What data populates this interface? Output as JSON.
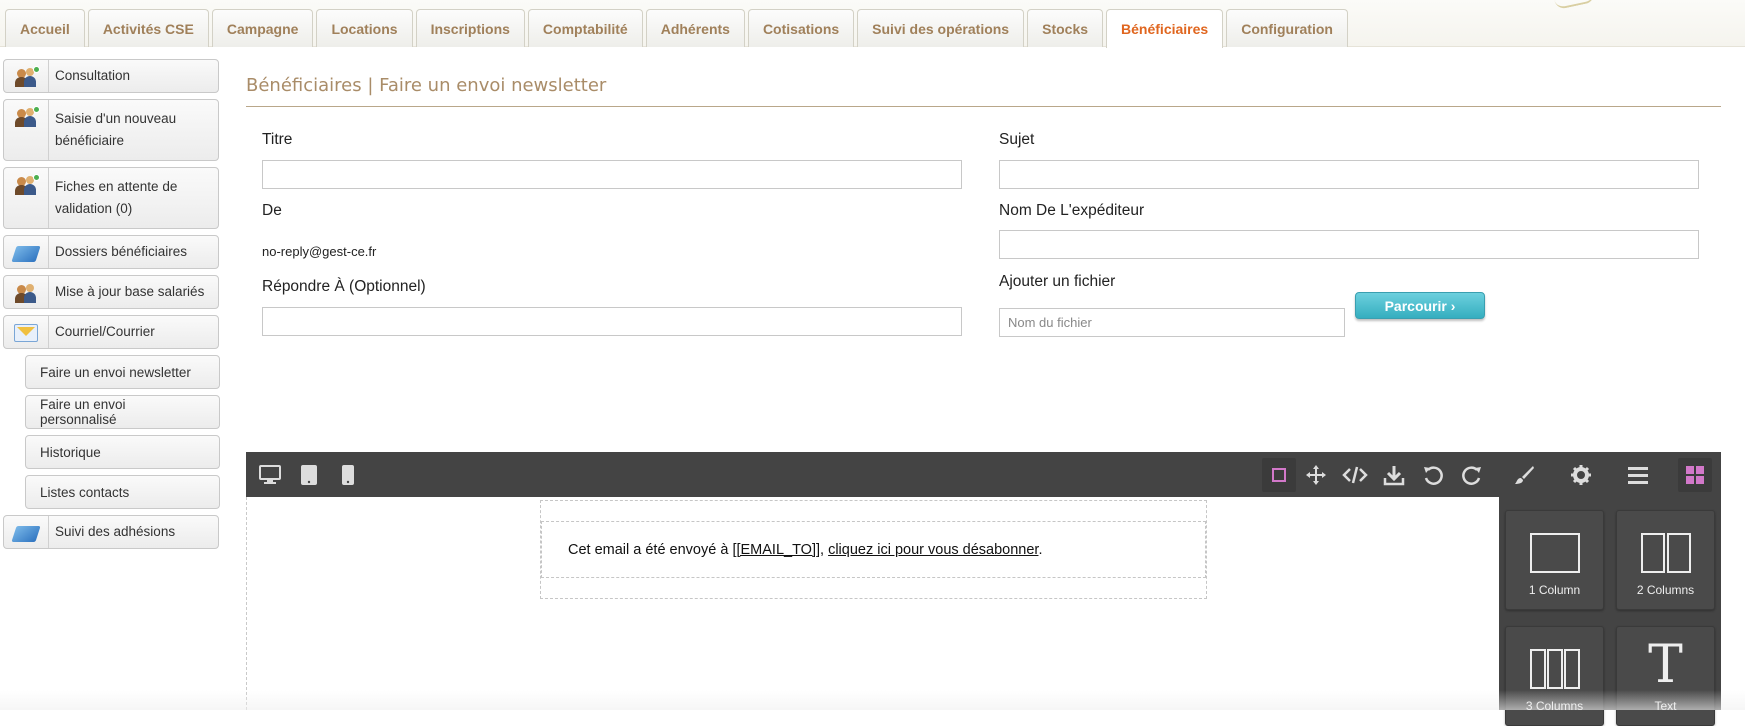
{
  "tabs": [
    {
      "label": "Accueil",
      "active": false
    },
    {
      "label": "Activités CSE",
      "active": false
    },
    {
      "label": "Campagne",
      "active": false
    },
    {
      "label": "Locations",
      "active": false
    },
    {
      "label": "Inscriptions",
      "active": false
    },
    {
      "label": "Comptabilité",
      "active": false
    },
    {
      "label": "Adhérents",
      "active": false
    },
    {
      "label": "Cotisations",
      "active": false
    },
    {
      "label": "Suivi des opérations",
      "active": false
    },
    {
      "label": "Stocks",
      "active": false
    },
    {
      "label": "Bénéficiaires",
      "active": true
    },
    {
      "label": "Configuration",
      "active": false
    }
  ],
  "sidebar": {
    "items": [
      {
        "label": "Consultation",
        "icon": "people-icon"
      },
      {
        "label": "Saisie d'un nouveau bénéficiaire",
        "icon": "people-icon"
      },
      {
        "label": "Fiches en attente de validation (0)",
        "icon": "people-icon"
      },
      {
        "label": "Dossiers bénéficiaires",
        "icon": "book-icon"
      },
      {
        "label": "Mise à jour base salariés",
        "icon": "people-icon"
      },
      {
        "label": "Courriel/Courrier",
        "icon": "mail-icon"
      }
    ],
    "subitems": [
      {
        "label": "Faire un envoi newsletter"
      },
      {
        "label": "Faire un envoi personnalisé"
      },
      {
        "label": "Historique"
      },
      {
        "label": "Listes contacts"
      }
    ],
    "last_item": {
      "label": "Suivi des adhésions",
      "icon": "book-icon"
    }
  },
  "page": {
    "title": "Bénéficiaires | Faire un envoi newsletter"
  },
  "form": {
    "titre_label": "Titre",
    "titre_value": "",
    "sujet_label": "Sujet",
    "sujet_value": "",
    "de_label": "De",
    "de_value": "no-reply@gest-ce.fr",
    "nom_expediteur_label": "Nom De L'expéditeur",
    "nom_expediteur_value": "",
    "repondre_label": "Répondre À (Optionnel)",
    "repondre_value": "",
    "fichier_label": "Ajouter un fichier",
    "fichier_placeholder": "Nom du fichier",
    "parcourir_label": "Parcourir ›"
  },
  "editor": {
    "toolbar_left": [
      "desktop-icon",
      "tablet-icon",
      "mobile-icon"
    ],
    "toolbar_right": [
      "outline-icon",
      "move-icon",
      "code-icon",
      "download-icon",
      "undo-icon",
      "redo-icon"
    ],
    "panel_tabs": [
      "brush-icon",
      "gear-icon",
      "layers-icon",
      "blocks-icon"
    ],
    "footer_text_before": "Cet email a été envoyé à ",
    "footer_email_tag": "[[EMAIL_TO]]",
    "footer_separator": ", ",
    "footer_unsubscribe": "cliquez ici pour vous désabonner",
    "footer_end": ".",
    "blocks": [
      {
        "label": "1 Column",
        "icon": "one-column-icon"
      },
      {
        "label": "2 Columns",
        "icon": "two-columns-icon"
      },
      {
        "label": "3 Columns",
        "icon": "three-columns-icon"
      },
      {
        "label": "Text",
        "icon": "text-block-icon"
      }
    ]
  },
  "colors": {
    "accent_active_tab": "#e0661f",
    "tab_text": "#a0805a",
    "title": "#a98c68",
    "button": "#35aebf",
    "editor_dark": "#444444",
    "editor_highlight": "#d278c9"
  }
}
